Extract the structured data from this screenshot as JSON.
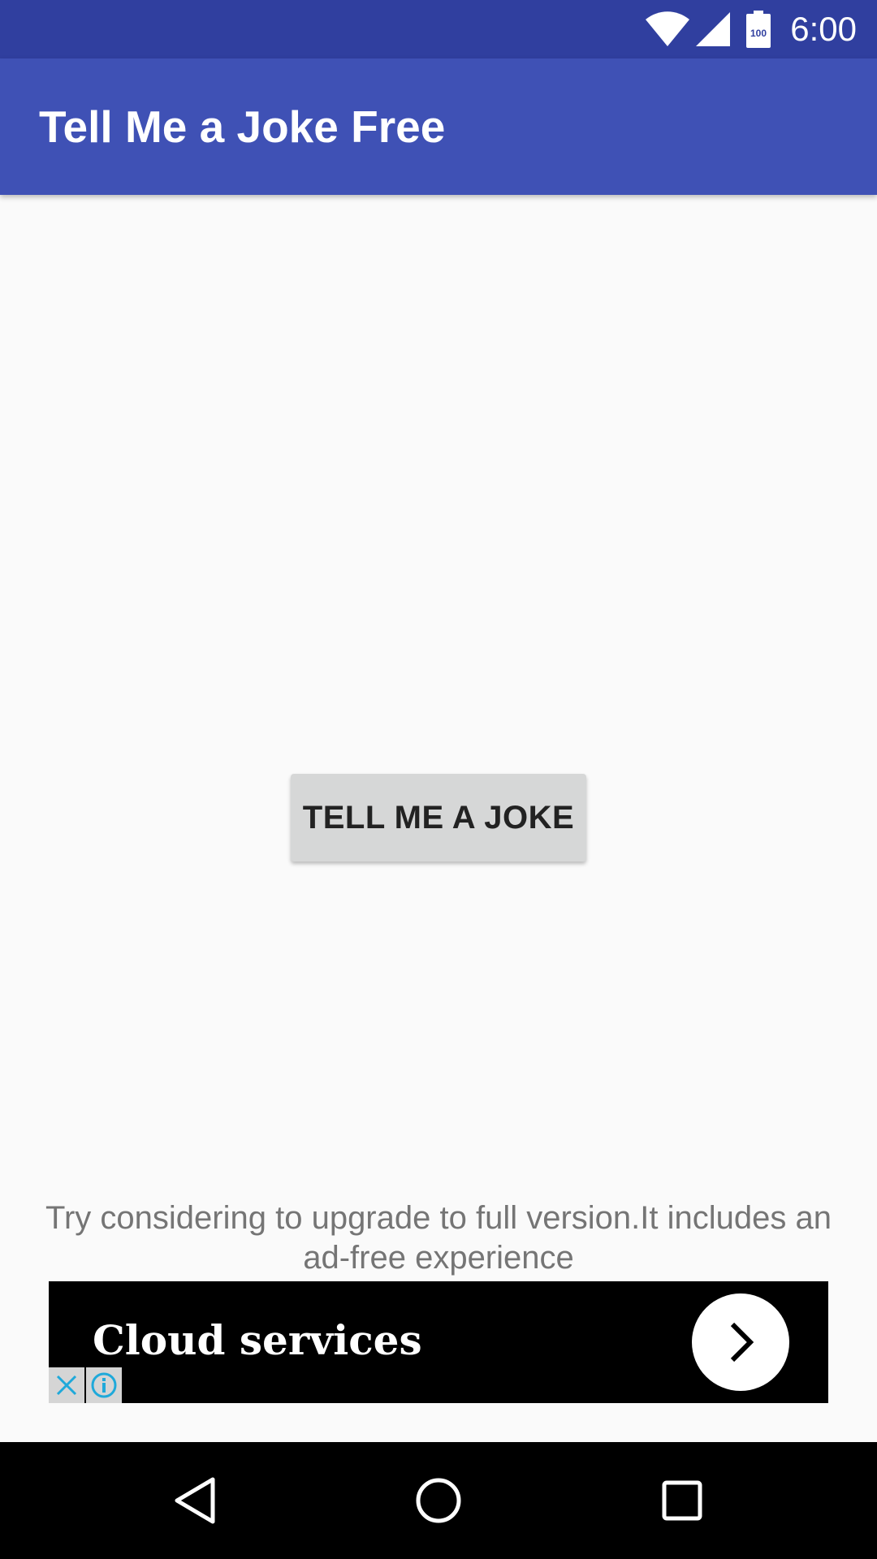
{
  "status_bar": {
    "time": "6:00",
    "battery_level": "100",
    "icons": [
      "wifi-icon",
      "signal-icon",
      "battery-icon"
    ]
  },
  "app_bar": {
    "title": "Tell Me a Joke Free"
  },
  "main": {
    "button_label": "TELL ME A JOKE",
    "upgrade_message": "Try considering to upgrade to full version.It includes an ad-free experience"
  },
  "ad": {
    "headline": "Cloud services",
    "icons": [
      "chevron-right-icon",
      "close-icon",
      "info-icon"
    ]
  },
  "navigation": {
    "icons": [
      "back-icon",
      "home-icon",
      "recents-icon"
    ]
  },
  "colors": {
    "status_bar": "#303F9F",
    "app_bar": "#3F51B5",
    "background": "#FAFAFA",
    "button": "#D6D7D7",
    "ad_background": "#000000",
    "ad_choices": "#1FA9DA"
  }
}
